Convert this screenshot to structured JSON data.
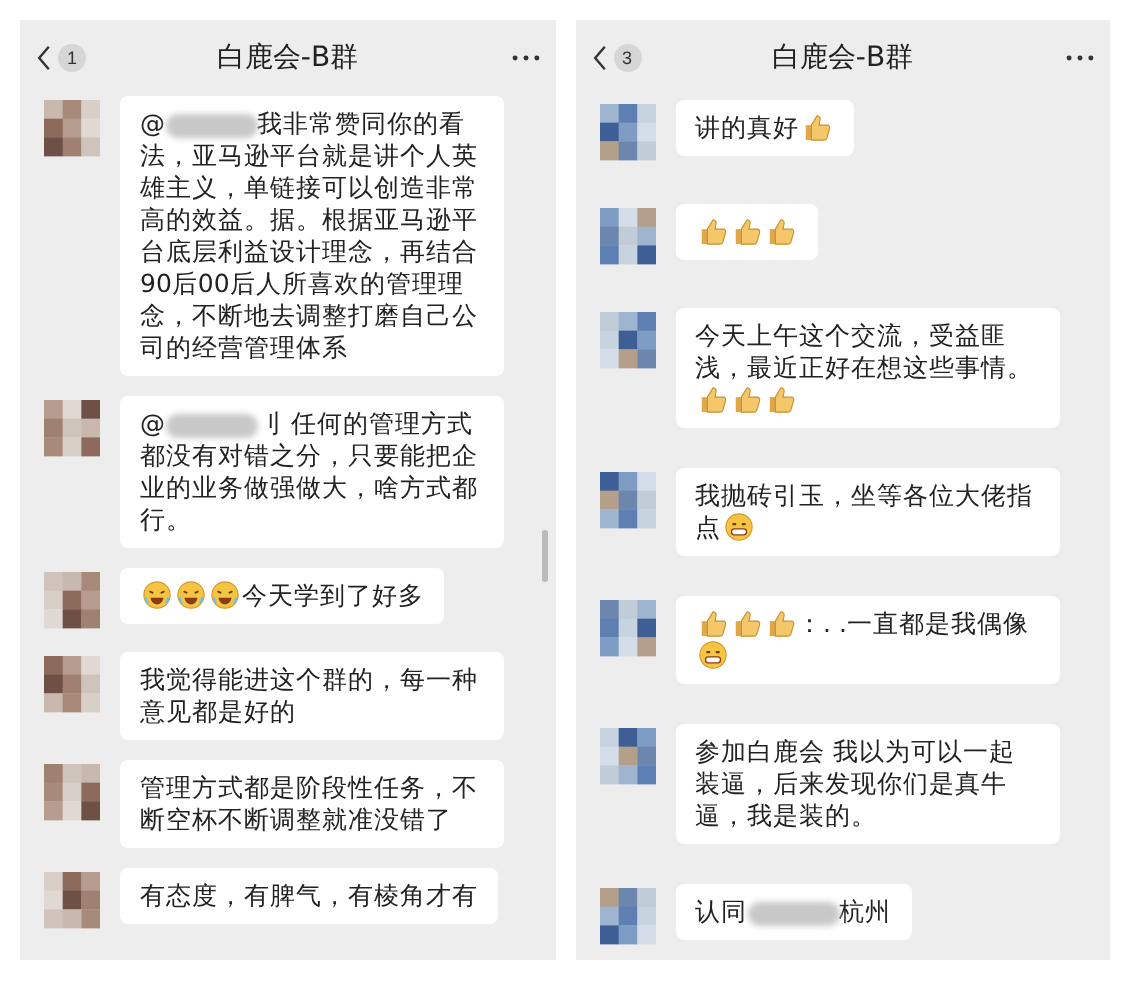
{
  "panels": [
    {
      "title": "白鹿会-B群",
      "unread": "1",
      "messages": [
        {
          "parts": [
            {
              "kind": "text",
              "text": "@"
            },
            {
              "kind": "redacted"
            },
            {
              "kind": "text",
              "text": "我非常赞同你的看法，亚马逊平台就是讲个人英雄主义，单链接可以创造非常高的效益。据。根据亚马逊平台底层利益设计理念，再结合90后00后人所喜欢的管理理念，不断地去调整打磨自己公司的经营管理体系"
            }
          ]
        },
        {
          "parts": [
            {
              "kind": "text",
              "text": "@"
            },
            {
              "kind": "redacted"
            },
            {
              "kind": "text",
              "text": "刂 任何的管理方式都没有对错之分，只要能把企业的业务做强做大，啥方式都行。"
            }
          ]
        },
        {
          "parts": [
            {
              "kind": "laughing"
            },
            {
              "kind": "laughing"
            },
            {
              "kind": "laughing"
            },
            {
              "kind": "text",
              "text": "今天学到了好多"
            }
          ]
        },
        {
          "parts": [
            {
              "kind": "text",
              "text": "我觉得能进这个群的，每一种意见都是好的"
            }
          ]
        },
        {
          "parts": [
            {
              "kind": "text",
              "text": "管理方式都是阶段性任务，不断空杯不断调整就准没错了"
            }
          ]
        },
        {
          "parts": [
            {
              "kind": "text",
              "text": "有态度，有脾气，有棱角才有"
            }
          ]
        }
      ]
    },
    {
      "title": "白鹿会-B群",
      "unread": "3",
      "messages": [
        {
          "parts": [
            {
              "kind": "text",
              "text": "讲的真好"
            },
            {
              "kind": "thumbs_up"
            }
          ]
        },
        {
          "parts": [
            {
              "kind": "thumbs_up"
            },
            {
              "kind": "thumbs_up"
            },
            {
              "kind": "thumbs_up"
            }
          ]
        },
        {
          "parts": [
            {
              "kind": "text",
              "text": "今天上午这个交流，受益匪浅，最近正好在想这些事情。"
            },
            {
              "kind": "thumbs_up"
            },
            {
              "kind": "thumbs_up"
            },
            {
              "kind": "thumbs_up"
            }
          ]
        },
        {
          "parts": [
            {
              "kind": "text",
              "text": "我抛砖引玉，坐等各位大佬指点"
            },
            {
              "kind": "grinning"
            }
          ]
        },
        {
          "parts": [
            {
              "kind": "thumbs_up"
            },
            {
              "kind": "thumbs_up"
            },
            {
              "kind": "thumbs_up"
            },
            {
              "kind": "text",
              "text": "：. .一直都是我偶像"
            },
            {
              "kind": "grinning"
            }
          ]
        },
        {
          "parts": [
            {
              "kind": "text",
              "text": "参加白鹿会 我以为可以一起装逼，后来发现你们是真牛逼，我是装的。"
            }
          ]
        },
        {
          "parts": [
            {
              "kind": "text",
              "text": "认同"
            },
            {
              "kind": "redacted"
            },
            {
              "kind": "text",
              "text": "杭州"
            }
          ]
        }
      ]
    }
  ]
}
